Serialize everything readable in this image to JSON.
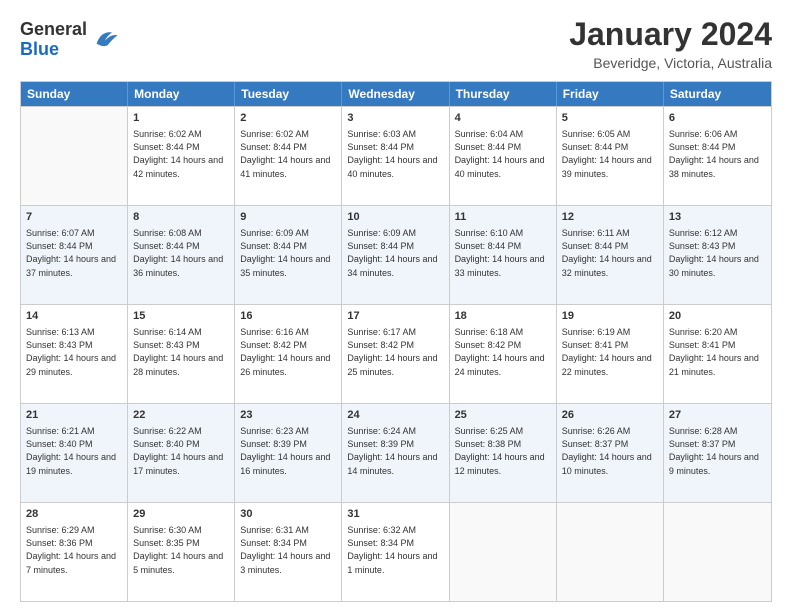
{
  "header": {
    "logo_general": "General",
    "logo_blue": "Blue",
    "month_year": "January 2024",
    "location": "Beveridge, Victoria, Australia"
  },
  "weekdays": [
    "Sunday",
    "Monday",
    "Tuesday",
    "Wednesday",
    "Thursday",
    "Friday",
    "Saturday"
  ],
  "rows": [
    [
      {
        "day": "",
        "empty": true
      },
      {
        "day": "1",
        "sunrise": "Sunrise: 6:02 AM",
        "sunset": "Sunset: 8:44 PM",
        "daylight": "Daylight: 14 hours and 42 minutes."
      },
      {
        "day": "2",
        "sunrise": "Sunrise: 6:02 AM",
        "sunset": "Sunset: 8:44 PM",
        "daylight": "Daylight: 14 hours and 41 minutes."
      },
      {
        "day": "3",
        "sunrise": "Sunrise: 6:03 AM",
        "sunset": "Sunset: 8:44 PM",
        "daylight": "Daylight: 14 hours and 40 minutes."
      },
      {
        "day": "4",
        "sunrise": "Sunrise: 6:04 AM",
        "sunset": "Sunset: 8:44 PM",
        "daylight": "Daylight: 14 hours and 40 minutes."
      },
      {
        "day": "5",
        "sunrise": "Sunrise: 6:05 AM",
        "sunset": "Sunset: 8:44 PM",
        "daylight": "Daylight: 14 hours and 39 minutes."
      },
      {
        "day": "6",
        "sunrise": "Sunrise: 6:06 AM",
        "sunset": "Sunset: 8:44 PM",
        "daylight": "Daylight: 14 hours and 38 minutes."
      }
    ],
    [
      {
        "day": "7",
        "sunrise": "Sunrise: 6:07 AM",
        "sunset": "Sunset: 8:44 PM",
        "daylight": "Daylight: 14 hours and 37 minutes."
      },
      {
        "day": "8",
        "sunrise": "Sunrise: 6:08 AM",
        "sunset": "Sunset: 8:44 PM",
        "daylight": "Daylight: 14 hours and 36 minutes."
      },
      {
        "day": "9",
        "sunrise": "Sunrise: 6:09 AM",
        "sunset": "Sunset: 8:44 PM",
        "daylight": "Daylight: 14 hours and 35 minutes."
      },
      {
        "day": "10",
        "sunrise": "Sunrise: 6:09 AM",
        "sunset": "Sunset: 8:44 PM",
        "daylight": "Daylight: 14 hours and 34 minutes."
      },
      {
        "day": "11",
        "sunrise": "Sunrise: 6:10 AM",
        "sunset": "Sunset: 8:44 PM",
        "daylight": "Daylight: 14 hours and 33 minutes."
      },
      {
        "day": "12",
        "sunrise": "Sunrise: 6:11 AM",
        "sunset": "Sunset: 8:44 PM",
        "daylight": "Daylight: 14 hours and 32 minutes."
      },
      {
        "day": "13",
        "sunrise": "Sunrise: 6:12 AM",
        "sunset": "Sunset: 8:43 PM",
        "daylight": "Daylight: 14 hours and 30 minutes."
      }
    ],
    [
      {
        "day": "14",
        "sunrise": "Sunrise: 6:13 AM",
        "sunset": "Sunset: 8:43 PM",
        "daylight": "Daylight: 14 hours and 29 minutes."
      },
      {
        "day": "15",
        "sunrise": "Sunrise: 6:14 AM",
        "sunset": "Sunset: 8:43 PM",
        "daylight": "Daylight: 14 hours and 28 minutes."
      },
      {
        "day": "16",
        "sunrise": "Sunrise: 6:16 AM",
        "sunset": "Sunset: 8:42 PM",
        "daylight": "Daylight: 14 hours and 26 minutes."
      },
      {
        "day": "17",
        "sunrise": "Sunrise: 6:17 AM",
        "sunset": "Sunset: 8:42 PM",
        "daylight": "Daylight: 14 hours and 25 minutes."
      },
      {
        "day": "18",
        "sunrise": "Sunrise: 6:18 AM",
        "sunset": "Sunset: 8:42 PM",
        "daylight": "Daylight: 14 hours and 24 minutes."
      },
      {
        "day": "19",
        "sunrise": "Sunrise: 6:19 AM",
        "sunset": "Sunset: 8:41 PM",
        "daylight": "Daylight: 14 hours and 22 minutes."
      },
      {
        "day": "20",
        "sunrise": "Sunrise: 6:20 AM",
        "sunset": "Sunset: 8:41 PM",
        "daylight": "Daylight: 14 hours and 21 minutes."
      }
    ],
    [
      {
        "day": "21",
        "sunrise": "Sunrise: 6:21 AM",
        "sunset": "Sunset: 8:40 PM",
        "daylight": "Daylight: 14 hours and 19 minutes."
      },
      {
        "day": "22",
        "sunrise": "Sunrise: 6:22 AM",
        "sunset": "Sunset: 8:40 PM",
        "daylight": "Daylight: 14 hours and 17 minutes."
      },
      {
        "day": "23",
        "sunrise": "Sunrise: 6:23 AM",
        "sunset": "Sunset: 8:39 PM",
        "daylight": "Daylight: 14 hours and 16 minutes."
      },
      {
        "day": "24",
        "sunrise": "Sunrise: 6:24 AM",
        "sunset": "Sunset: 8:39 PM",
        "daylight": "Daylight: 14 hours and 14 minutes."
      },
      {
        "day": "25",
        "sunrise": "Sunrise: 6:25 AM",
        "sunset": "Sunset: 8:38 PM",
        "daylight": "Daylight: 14 hours and 12 minutes."
      },
      {
        "day": "26",
        "sunrise": "Sunrise: 6:26 AM",
        "sunset": "Sunset: 8:37 PM",
        "daylight": "Daylight: 14 hours and 10 minutes."
      },
      {
        "day": "27",
        "sunrise": "Sunrise: 6:28 AM",
        "sunset": "Sunset: 8:37 PM",
        "daylight": "Daylight: 14 hours and 9 minutes."
      }
    ],
    [
      {
        "day": "28",
        "sunrise": "Sunrise: 6:29 AM",
        "sunset": "Sunset: 8:36 PM",
        "daylight": "Daylight: 14 hours and 7 minutes."
      },
      {
        "day": "29",
        "sunrise": "Sunrise: 6:30 AM",
        "sunset": "Sunset: 8:35 PM",
        "daylight": "Daylight: 14 hours and 5 minutes."
      },
      {
        "day": "30",
        "sunrise": "Sunrise: 6:31 AM",
        "sunset": "Sunset: 8:34 PM",
        "daylight": "Daylight: 14 hours and 3 minutes."
      },
      {
        "day": "31",
        "sunrise": "Sunrise: 6:32 AM",
        "sunset": "Sunset: 8:34 PM",
        "daylight": "Daylight: 14 hours and 1 minute."
      },
      {
        "day": "",
        "empty": true
      },
      {
        "day": "",
        "empty": true
      },
      {
        "day": "",
        "empty": true
      }
    ]
  ]
}
